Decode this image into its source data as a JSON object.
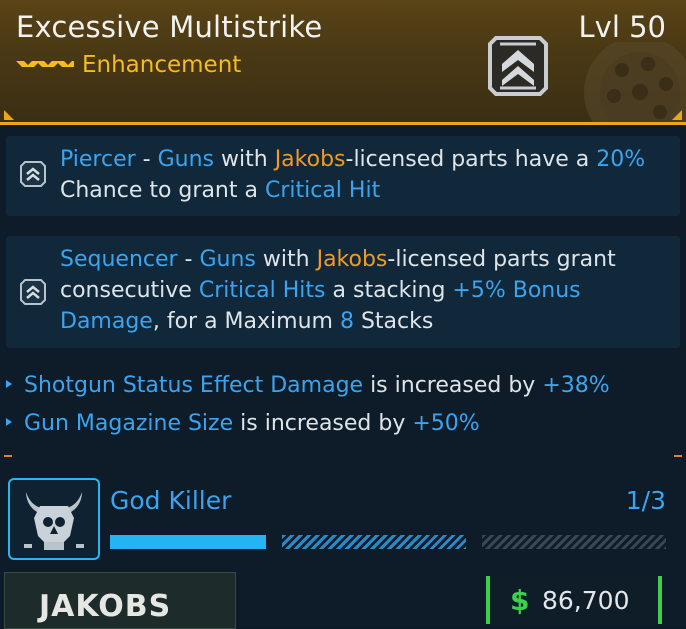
{
  "header": {
    "title": "Excessive Multistrike",
    "subtitle": "Enhancement",
    "level": "Lvl 50",
    "rarity_color": "#f5bb21",
    "emblem_icon": "chevron-badge-icon"
  },
  "perks": [
    {
      "icon": "chevron-up-icon",
      "segments": [
        {
          "text": "Piercer",
          "color": "blue"
        },
        {
          "text": " - ",
          "color": "white"
        },
        {
          "text": "Guns",
          "color": "blue"
        },
        {
          "text": " with ",
          "color": "white"
        },
        {
          "text": "Jakobs",
          "color": "orange"
        },
        {
          "text": "-licensed parts have a ",
          "color": "white"
        },
        {
          "text": "20%",
          "color": "blue"
        },
        {
          "text": " Chance to grant a ",
          "color": "white"
        },
        {
          "text": "Critical Hit",
          "color": "blue"
        }
      ]
    },
    {
      "icon": "chevron-up-icon",
      "segments": [
        {
          "text": "Sequencer",
          "color": "blue"
        },
        {
          "text": " - ",
          "color": "white"
        },
        {
          "text": "Guns",
          "color": "blue"
        },
        {
          "text": " with ",
          "color": "white"
        },
        {
          "text": "Jakobs",
          "color": "orange"
        },
        {
          "text": "-licensed parts grant consecutive ",
          "color": "white"
        },
        {
          "text": "Critical Hits",
          "color": "blue"
        },
        {
          "text": " a stacking ",
          "color": "white"
        },
        {
          "text": "+5%",
          "color": "blue"
        },
        {
          "text": " Bonus Damage",
          "color": "blue"
        },
        {
          "text": ", for a Maximum ",
          "color": "white"
        },
        {
          "text": "8",
          "color": "blue"
        },
        {
          "text": " Stacks",
          "color": "white"
        }
      ]
    }
  ],
  "stats": [
    {
      "name": "Shotgun Status Effect Damage",
      "mid": " is increased by ",
      "value": "+38%"
    },
    {
      "name": "Gun Magazine Size",
      "mid": " is increased by ",
      "value": "+50%"
    }
  ],
  "set_bonus": {
    "name": "God Killer",
    "count": "1/3",
    "icon": "horned-skull-icon",
    "progress_filled": 1,
    "progress_total": 3
  },
  "footer": {
    "manufacturer": "JAKOBS",
    "currency_symbol": "$",
    "price": "86,700",
    "price_color": "#3bd14a"
  },
  "colors": {
    "accent_blue": "#3ba4f0",
    "accent_orange": "#f29a22",
    "header_border": "#e9a81c"
  }
}
